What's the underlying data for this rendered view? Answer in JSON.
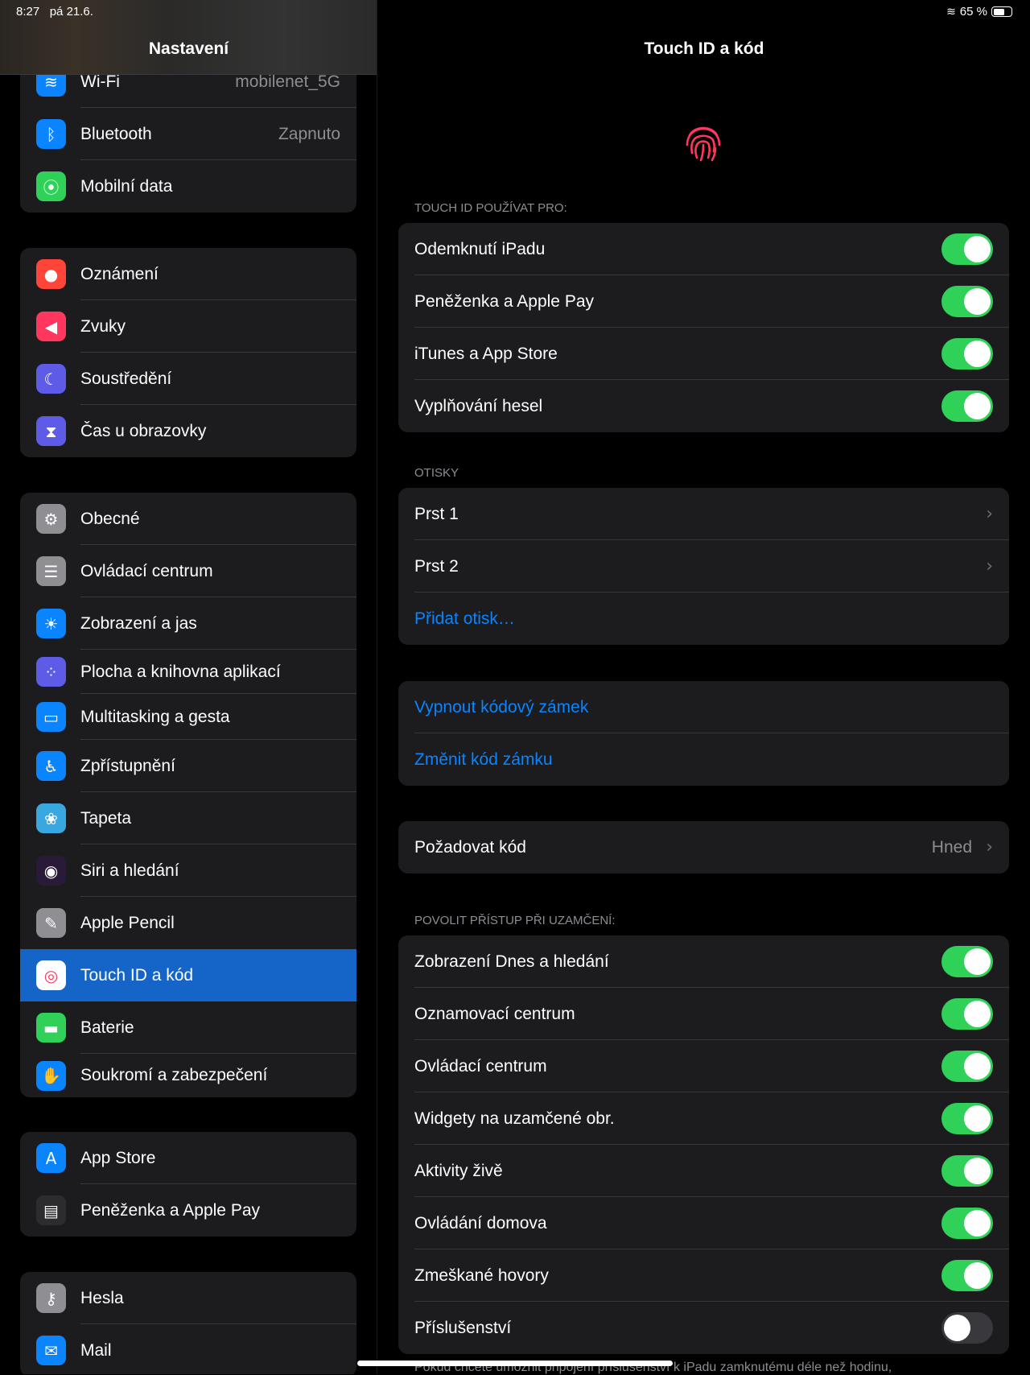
{
  "status_bar": {
    "time": "8:27",
    "date": "pá 21.6.",
    "battery": "65 %",
    "battery_level": 0.65
  },
  "sidebar": {
    "title": "Nastavení",
    "groups": [
      [
        {
          "label": "Wi-Fi",
          "value": "mobilenet_5G",
          "icon": "wifi-icon",
          "color": "#0a84ff",
          "glyph": "≋"
        },
        {
          "label": "Bluetooth",
          "value": "Zapnuto",
          "icon": "bluetooth-icon",
          "color": "#0a84ff",
          "glyph": "ᛒ"
        },
        {
          "label": "Mobilní data",
          "icon": "antenna-icon",
          "color": "#30d158",
          "glyph": "⦿"
        }
      ],
      [
        {
          "label": "Oznámení",
          "icon": "bell-icon",
          "color": "#ff453a",
          "glyph": "●"
        },
        {
          "label": "Zvuky",
          "icon": "speaker-icon",
          "color": "#ff375f",
          "glyph": "◀"
        },
        {
          "label": "Soustředění",
          "icon": "moon-icon",
          "color": "#5e5ce6",
          "glyph": "☾"
        },
        {
          "label": "Čas u obrazovky",
          "icon": "hourglass-icon",
          "color": "#5e5ce6",
          "glyph": "⧗"
        }
      ],
      [
        {
          "label": "Obecné",
          "icon": "gear-icon",
          "color": "#8e8e93",
          "glyph": "⚙"
        },
        {
          "label": "Ovládací centrum",
          "icon": "switches-icon",
          "color": "#8e8e93",
          "glyph": "☰"
        },
        {
          "label": "Zobrazení a jas",
          "icon": "sun-icon",
          "color": "#0a84ff",
          "glyph": "☀"
        },
        {
          "label": "Plocha a knihovna aplikací",
          "icon": "app-grid-icon",
          "color": "#5e5ce6",
          "glyph": "⁘"
        },
        {
          "label": "Multitasking a gesta",
          "icon": "multitasking-icon",
          "color": "#0a84ff",
          "glyph": "▭"
        },
        {
          "label": "Zpřístupnění",
          "icon": "accessibility-icon",
          "color": "#0a84ff",
          "glyph": "♿"
        },
        {
          "label": "Tapeta",
          "icon": "flower-icon",
          "color": "#3aa8e0",
          "glyph": "❀"
        },
        {
          "label": "Siri a hledání",
          "icon": "siri-icon",
          "color": "#2a1a3a",
          "glyph": "◉"
        },
        {
          "label": "Apple Pencil",
          "icon": "pencil-icon",
          "color": "#8e8e93",
          "glyph": "✎"
        },
        {
          "label": "Touch ID a kód",
          "icon": "fingerprint-icon",
          "color": "#ffffff",
          "glyph": "◎",
          "selected": true
        },
        {
          "label": "Baterie",
          "icon": "battery-icon",
          "color": "#30d158",
          "glyph": "▬"
        },
        {
          "label": "Soukromí a zabezpečení",
          "icon": "hand-icon",
          "color": "#0a84ff",
          "glyph": "✋"
        }
      ],
      [
        {
          "label": "App Store",
          "icon": "app-store-icon",
          "color": "#0a84ff",
          "glyph": "A"
        },
        {
          "label": "Peněženka a Apple Pay",
          "icon": "wallet-icon",
          "color": "#2c2c2e",
          "glyph": "▤"
        }
      ],
      [
        {
          "label": "Hesla",
          "icon": "key-icon",
          "color": "#8e8e93",
          "glyph": "⚷"
        },
        {
          "label": "Mail",
          "icon": "mail-icon",
          "color": "#0a84ff",
          "glyph": "✉"
        }
      ]
    ]
  },
  "detail": {
    "title": "Touch ID a kód",
    "accent": "#0a84ff",
    "toggle_on_color": "#30d158",
    "sections": [
      {
        "header": "Touch ID používat pro:",
        "rows": [
          {
            "label": "Odemknutí iPadu",
            "toggle": true
          },
          {
            "label": "Peněženka a Apple Pay",
            "toggle": true
          },
          {
            "label": "iTunes a App Store",
            "toggle": true
          },
          {
            "label": "Vyplňování hesel",
            "toggle": true
          }
        ]
      },
      {
        "header": "Otisky",
        "rows": [
          {
            "label": "Prst 1",
            "chevron": true
          },
          {
            "label": "Prst 2",
            "chevron": true
          },
          {
            "label": "Přidat otisk…",
            "link": true
          }
        ]
      },
      {
        "header": "",
        "rows": [
          {
            "label": "Vypnout kódový zámek",
            "link": true
          },
          {
            "label": "Změnit kód zámku",
            "link": true
          }
        ]
      },
      {
        "header": "",
        "rows": [
          {
            "label": "Požadovat kód",
            "value": "Hned",
            "chevron": true
          }
        ]
      },
      {
        "header": "Povolit přístup při uzamčení:",
        "rows": [
          {
            "label": "Zobrazení Dnes a hledání",
            "toggle": true
          },
          {
            "label": "Oznamovací centrum",
            "toggle": true
          },
          {
            "label": "Ovládací centrum",
            "toggle": true
          },
          {
            "label": "Widgety na uzamčené obr.",
            "toggle": true
          },
          {
            "label": "Aktivity živě",
            "toggle": true
          },
          {
            "label": "Ovládání domova",
            "toggle": true
          },
          {
            "label": "Zmeškané hovory",
            "toggle": true
          },
          {
            "label": "Příslušenství",
            "toggle": false
          }
        ]
      }
    ],
    "footer": "Pokud chcete umožnit připojení příslušenství k iPadu zamknutému déle než hodinu,"
  }
}
